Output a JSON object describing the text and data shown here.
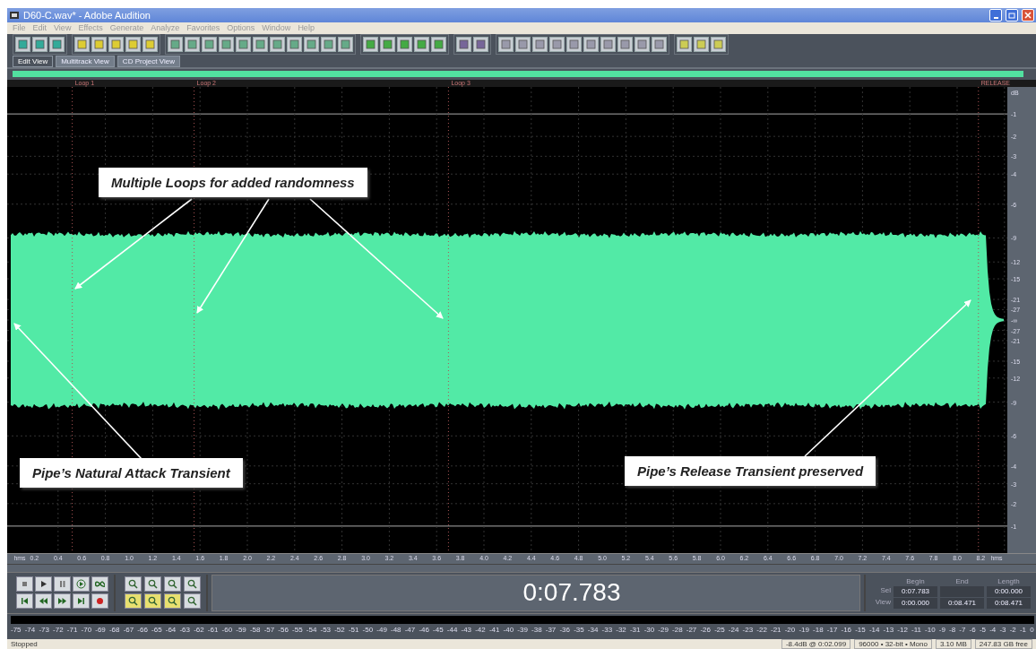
{
  "window": {
    "title": "D60-C.wav* - Adobe Audition"
  },
  "menu": [
    "File",
    "Edit",
    "View",
    "Effects",
    "Generate",
    "Analyze",
    "Favorites",
    "Options",
    "Window",
    "Help"
  ],
  "tabs": [
    {
      "label": "Edit View",
      "selected": true
    },
    {
      "label": "Multitrack View",
      "selected": false
    },
    {
      "label": "CD Project View",
      "selected": false
    }
  ],
  "markers": [
    "Loop 1",
    "Loop 2",
    "Loop 3",
    "RELEASE"
  ],
  "db_scale": [
    "dB",
    "-1",
    "-2",
    "-3",
    "-4",
    "-6",
    "-9",
    "-12",
    "-15",
    "-21",
    "-27",
    "-∞",
    "-27",
    "-21",
    "-15",
    "-12",
    "-9",
    "-6",
    "-4",
    "-3",
    "-2",
    "-1"
  ],
  "callouts": [
    "Multiple Loops for added randomness",
    "Pipe’s Natural Attack Transient",
    "Pipe’s Release Transient preserved"
  ],
  "time_ruler": {
    "unit_left": "hms",
    "ticks": [
      "0.2",
      "0.4",
      "0.6",
      "0.8",
      "1.0",
      "1.2",
      "1.4",
      "1.6",
      "1.8",
      "2.0",
      "2.2",
      "2.4",
      "2.6",
      "2.8",
      "3.0",
      "3.2",
      "3.4",
      "3.6",
      "3.8",
      "4.0",
      "4.2",
      "4.4",
      "4.6",
      "4.8",
      "5.0",
      "5.2",
      "5.4",
      "5.6",
      "5.8",
      "6.0",
      "6.2",
      "6.4",
      "6.6",
      "6.8",
      "7.0",
      "7.2",
      "7.4",
      "7.6",
      "7.8",
      "8.0",
      "8.2"
    ],
    "unit_right": "hms"
  },
  "time_display": "0:07.783",
  "selection": {
    "columns": [
      "Begin",
      "End",
      "Length"
    ],
    "rows": [
      {
        "label": "Sel",
        "begin": "0:07.783",
        "length": "0:00.000"
      },
      {
        "label": "View",
        "begin": "0:00.000",
        "end": "0:08.471",
        "length": "0:08.471"
      }
    ]
  },
  "meter_scale": [
    "-75",
    "-74",
    "-73",
    "-72",
    "-71",
    "-70",
    "-69",
    "-68",
    "-67",
    "-66",
    "-65",
    "-64",
    "-63",
    "-62",
    "-61",
    "-60",
    "-59",
    "-58",
    "-57",
    "-56",
    "-55",
    "-54",
    "-53",
    "-52",
    "-51",
    "-50",
    "-49",
    "-48",
    "-47",
    "-46",
    "-45",
    "-44",
    "-43",
    "-42",
    "-41",
    "-40",
    "-39",
    "-38",
    "-37",
    "-36",
    "-35",
    "-34",
    "-33",
    "-32",
    "-31",
    "-30",
    "-29",
    "-28",
    "-27",
    "-26",
    "-25",
    "-24",
    "-23",
    "-22",
    "-21",
    "-20",
    "-19",
    "-18",
    "-17",
    "-16",
    "-15",
    "-14",
    "-13",
    "-12",
    "-11",
    "-10",
    "-9",
    "-8",
    "-7",
    "-6",
    "-5",
    "-4",
    "-3",
    "-2",
    "-1",
    "0"
  ],
  "status_bar": {
    "state": "Stopped",
    "fields": [
      "-8.4dB @ 0:02.099",
      "96000 • 32-bit • Mono",
      "3.10 MB",
      "247.83 GB free"
    ]
  }
}
